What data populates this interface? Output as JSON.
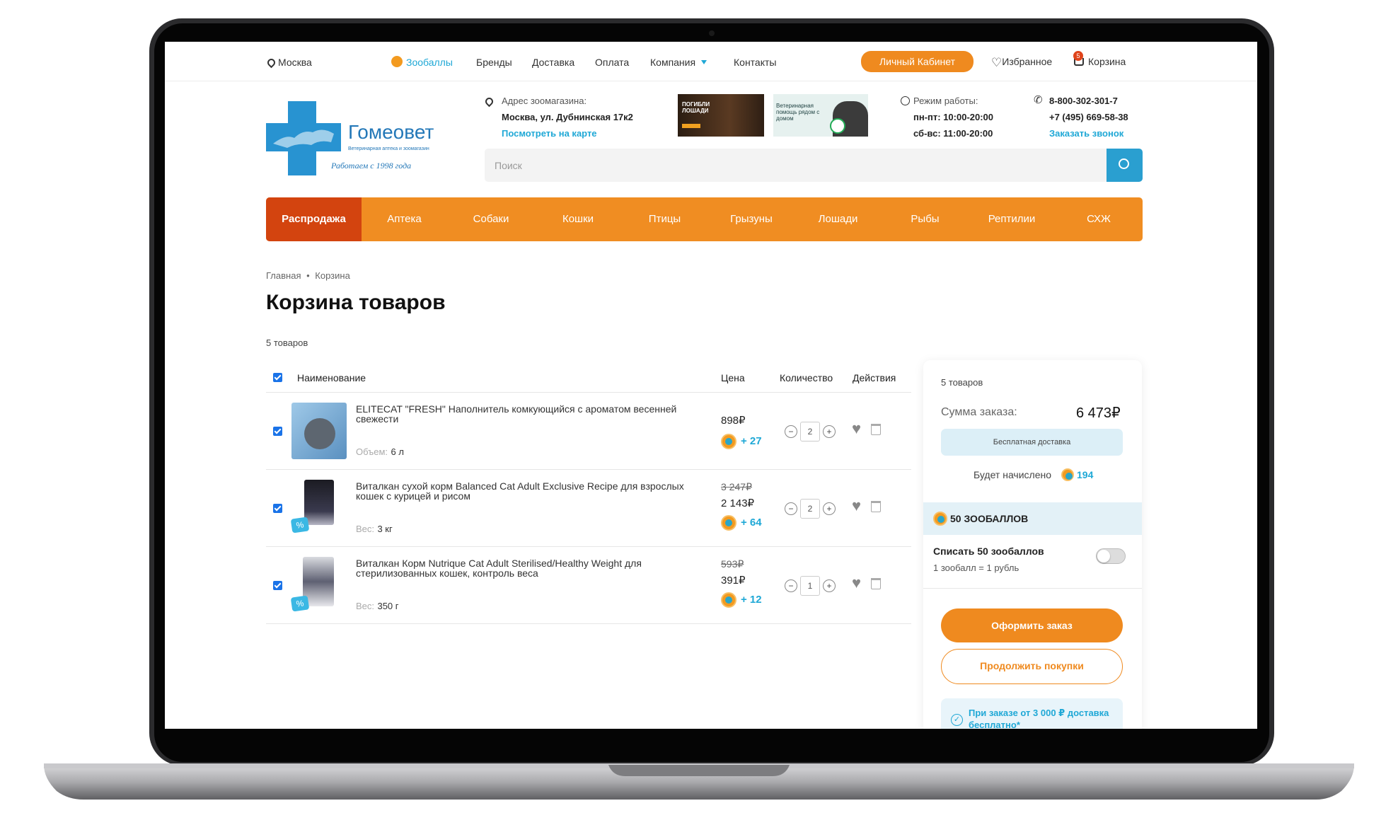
{
  "topbar": {
    "city": "Москва",
    "links": [
      "Зообаллы",
      "Бренды",
      "Доставка",
      "Оплата",
      "Компания",
      "Контакты"
    ],
    "cabinet": "Личный Кабинет",
    "favorites": "Избранное",
    "cart": "Корзина",
    "cart_count": "5"
  },
  "header": {
    "logo_name": "Гомеовет",
    "logo_sub": "Ветеринарная аптека и зоомагазин",
    "logo_slogan": "Работаем с 1998 года",
    "address_label": "Адрес зоомагазина:",
    "address": "Москва, ул. Дубнинская 17к2",
    "map_link": "Посмотреть на карте",
    "banner1": "ПОГИБЛИ ЛОШАДИ",
    "banner2": "Ветеринарная помощь рядом с домом",
    "hours_label": "Режим работы:",
    "hours1": "пн-пт: 10:00-20:00",
    "hours2": "сб-вс: 11:00-20:00",
    "phone1": "8-800-302-301-7",
    "phone2": "+7 (495) 669-58-38",
    "callback": "Заказать звонок",
    "search_placeholder": "Поиск"
  },
  "nav": [
    "Распродажа",
    "Аптека",
    "Собаки",
    "Кошки",
    "Птицы",
    "Грызуны",
    "Лошади",
    "Рыбы",
    "Рептилии",
    "СХЖ"
  ],
  "page": {
    "breadcrumb_home": "Главная",
    "breadcrumb_sep": "•",
    "breadcrumb_current": "Корзина",
    "title": "Корзина товаров",
    "count": "5 товаров"
  },
  "table": {
    "col_name": "Наименование",
    "col_price": "Цена",
    "col_qty": "Количество",
    "col_actions": "Действия",
    "items": [
      {
        "name": "ELITECAT \"FRESH\" Наполнитель комкующийся с ароматом весенней свежести",
        "attr_label": "Объем:",
        "attr_value": "6 л",
        "old_price": "",
        "price": "898₽",
        "bonus": "+ 27",
        "qty": "2"
      },
      {
        "name": "Виталкан сухой корм Balanced Cat Adult Exclusive Recipe для взрослых кошек с курицей и рисом",
        "attr_label": "Вес:",
        "attr_value": "3 кг",
        "old_price": "3 247₽",
        "price": "2 143₽",
        "bonus": "+ 64",
        "qty": "2"
      },
      {
        "name": "Виталкан Корм Nutrique Cat Adult Sterilised/Healthy Weight для стерилизованных кошек, контроль веса",
        "attr_label": "Вес:",
        "attr_value": "350 г",
        "old_price": "593₽",
        "price": "391₽",
        "bonus": "+ 12",
        "qty": "1"
      }
    ]
  },
  "summary": {
    "count": "5 товаров",
    "total_label": "Сумма заказа:",
    "total": "6 473₽",
    "free_delivery": "Бесплатная доставка",
    "accrual_label": "Будет начислено",
    "accrual_value": "194",
    "points_title": "50 ЗООБАЛЛОВ",
    "writeoff": "Списать 50 зообаллов",
    "rate": "1 зообалл = 1 рубль",
    "checkout": "Оформить заказ",
    "continue": "Продолжить покупки",
    "notice": "При заказе от 3 000 ₽ доставка бесплатно*"
  },
  "colors": {
    "orange": "#ef8a1f",
    "sale": "#d3440f",
    "accent": "#1fa8d6",
    "search_btn": "#2a9fd0"
  }
}
